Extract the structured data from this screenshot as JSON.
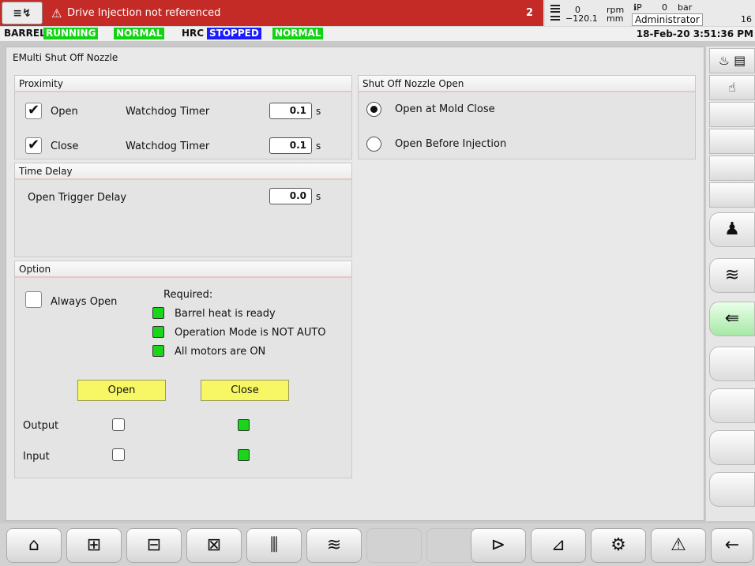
{
  "topbar": {
    "alarm_button_icon": "≡↯",
    "alarm_icon": "⚠",
    "alarm_text": "Drive Injection not referenced",
    "alarm_count": "2",
    "screw_top_value": "0",
    "screw_top_unit": "rpm",
    "screw_bottom_value": "−120.1",
    "screw_bottom_unit": "mm",
    "pressure_label": "ℹP",
    "pressure_value": "0",
    "pressure_unit": "bar",
    "user": "Administrator",
    "user_extra": "16"
  },
  "status": {
    "barrel_label": "BARREL",
    "barrel_state": "RUNNING",
    "barrel_mode": "NORMAL",
    "hrc_label": "HRC",
    "hrc_state": "STOPPED",
    "hrc_mode": "NORMAL",
    "datetime": "18-Feb-20 3:51:36 PM"
  },
  "screen": {
    "title": "EMulti Shut Off Nozzle"
  },
  "proximity": {
    "header": "Proximity",
    "open_label": "Open",
    "open_timer_label": "Watchdog Timer",
    "open_timer_value": "0.1",
    "close_label": "Close",
    "close_timer_label": "Watchdog Timer",
    "close_timer_value": "0.1",
    "unit": "s",
    "open_checked": true,
    "close_checked": true
  },
  "time_delay": {
    "header": "Time Delay",
    "trigger_label": "Open Trigger Delay",
    "trigger_value": "0.0",
    "unit": "s"
  },
  "option": {
    "header": "Option",
    "always_open_label": "Always Open",
    "required_label": "Required:",
    "req1": "Barrel heat is ready",
    "req2": "Operation Mode is NOT AUTO",
    "req3": "All motors are ON",
    "open_button": "Open",
    "close_button": "Close",
    "output_label": "Output",
    "input_label": "Input"
  },
  "shutoff": {
    "header": "Shut Off Nozzle Open",
    "option1": "Open at Mold Close",
    "option2": "Open Before Injection",
    "selected": "Open at Mold Close"
  },
  "colors": {
    "alarm": "#c42a26",
    "running": "#12d312",
    "stopped": "#1b1bff",
    "led_on": "#19d619",
    "yellow_button": "#f7f765"
  }
}
